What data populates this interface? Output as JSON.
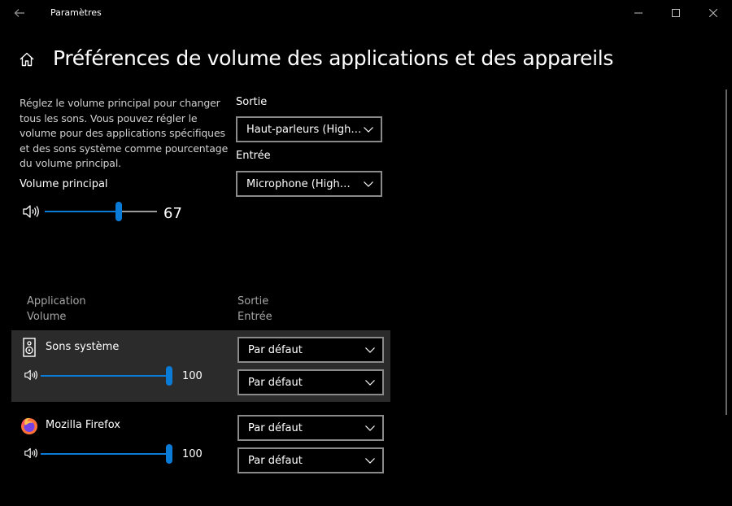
{
  "window": {
    "title": "Paramètres"
  },
  "page": {
    "title": "Préférences de volume des applications et des appareils",
    "description": "Réglez le volume principal pour changer tous les sons. Vous pouvez régler le volume pour des applications spécifiques et des sons système comme pourcentage du volume principal."
  },
  "master": {
    "label": "Volume principal",
    "value": 67,
    "value_text": "67"
  },
  "devices": {
    "output_label": "Sortie",
    "output_value": "Haut-parleurs (High…",
    "input_label": "Entrée",
    "input_value": "Microphone (High…"
  },
  "columns": {
    "app_line1": "Application",
    "app_line2": "Volume",
    "io_line1": "Sortie",
    "io_line2": "Entrée"
  },
  "apps": [
    {
      "name": "Sons système",
      "icon": "speaker-box-icon",
      "volume": 100,
      "volume_text": "100",
      "output": "Par défaut",
      "input": "Par défaut",
      "selected": true
    },
    {
      "name": "Mozilla Firefox",
      "icon": "firefox-icon",
      "volume": 100,
      "volume_text": "100",
      "output": "Par défaut",
      "input": "Par défaut",
      "selected": false
    }
  ],
  "colors": {
    "accent": "#0a7bd6",
    "background": "#000000",
    "selected_row": "#2b2b2b"
  }
}
